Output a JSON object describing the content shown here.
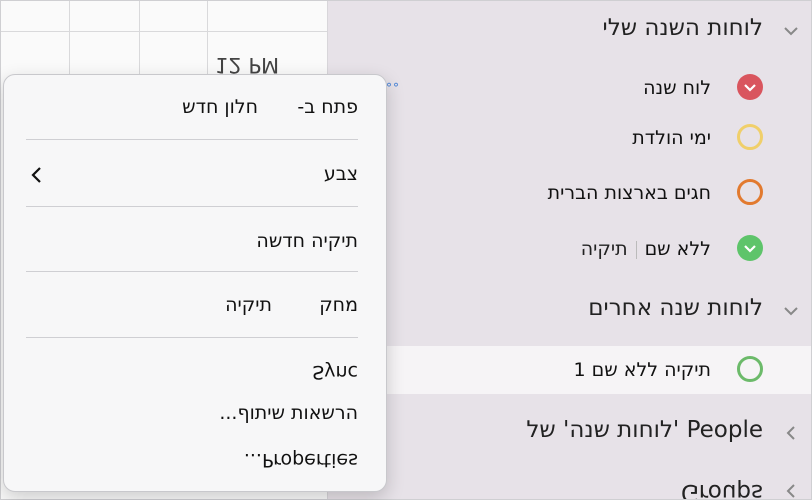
{
  "calendar": {
    "time_label": "12 PM",
    "dots": "°°"
  },
  "sidebar": {
    "sections": [
      {
        "title": "לוחות השנה שלי",
        "expanded": true
      },
      {
        "title": "לוחות שנה אחרים",
        "expanded": true
      },
      {
        "title": "People 'לוחות שנה' של",
        "expanded": false
      },
      {
        "title": "Groups",
        "expanded": false
      }
    ],
    "my_calendars": [
      {
        "label": "לוח שנה",
        "color": "#d9555e",
        "checked": true
      },
      {
        "label": "ימי הולדת",
        "color": "#f0cf6a",
        "checked": false
      },
      {
        "label": "חגים בארצות הברית",
        "color": "#e27a2f",
        "checked": false
      },
      {
        "label": "ללא שם",
        "folder": "תיקיה",
        "color": "#5ec46a",
        "checked": true
      }
    ],
    "other_calendars": [
      {
        "label": "תיקיה ללא שם 1",
        "color": "#6cba6a",
        "checked": false
      }
    ]
  },
  "context_menu": {
    "open_in": "פתח ב-",
    "new_window": "חלון חדש",
    "color": "צבע",
    "new_folder": "תיקיה חדשה",
    "delete": "מחק",
    "folder": "תיקיה",
    "sync": "Sync",
    "sharing_permissions": "הרשאות שיתוף...",
    "properties": "Properties..."
  },
  "colors": {
    "sidebar_bg": "#e7e2e8",
    "menu_bg": "#f7f7f8",
    "selected_row": "#f6f4f6"
  }
}
